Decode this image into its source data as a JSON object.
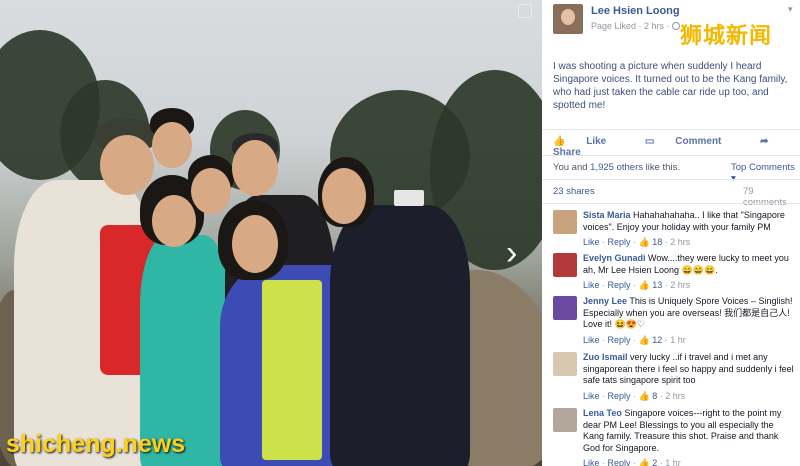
{
  "watermark": "shicheng.news",
  "header": {
    "page_name": "Lee Hsien Loong",
    "meta": "Page Liked · 2 hrs ·",
    "brand": "狮城新闻"
  },
  "post": {
    "text": "I was shooting a picture when suddenly I heard Singapore voices. It turned out to be the Kang family, who had just taken the cable car ride up too, and spotted me!"
  },
  "actions": {
    "like": "Like",
    "comment": "Comment",
    "share": "Share"
  },
  "stats": {
    "likes_prefix": "You and ",
    "likes_link": "1,925 others",
    "likes_suffix": " like this.",
    "top_comments": "Top Comments ▾",
    "shares": "23 shares",
    "comments": "79 comments"
  },
  "comments": [
    {
      "name": "Sista Maria",
      "text": "Hahahahahaha.. I like that \"Singapore voices\". Enjoy your holiday with your family PM",
      "like": "Like",
      "reply": "Reply",
      "likes_count": "18",
      "time": "2 hrs",
      "avatar_color": "#c9a27e"
    },
    {
      "name": "Evelyn Gunadi",
      "text": "Wow....they were lucky to meet you ah, Mr Lee Hsien Loong 😄😄😄.",
      "like": "Like",
      "reply": "Reply",
      "likes_count": "13",
      "time": "2 hrs",
      "avatar_color": "#b33a3a"
    },
    {
      "name": "Jenny Lee",
      "text": "This is Uniquely Spore Voices – Singlish! Especially when you are overseas! 我们都是自己人! Love it! 😆😍♡",
      "like": "Like",
      "reply": "Reply",
      "likes_count": "12",
      "time": "1 hr",
      "avatar_color": "#6a4aa0"
    },
    {
      "name": "Zuo Ismail",
      "text": "very lucky ..if i travel and i met any singaporean there i feel so happy and suddenly i feel safe tats singapore spirit too",
      "like": "Like",
      "reply": "Reply",
      "likes_count": "8",
      "time": "2 hrs",
      "avatar_color": "#d8c7b0"
    },
    {
      "name": "Lena Teo",
      "text": "Singapore voices---right to the point my dear PM Lee! Blessings to you all especially the Kang family. Treasure this shot. Praise and thank God for Singapore.",
      "like": "Like",
      "reply": "Reply",
      "likes_count": "2",
      "time": "1 hr",
      "avatar_color": "#b0a69a"
    }
  ],
  "icons": {
    "expand": "expand-icon",
    "next": "chevron-right-icon",
    "globe": "globe-icon",
    "like_thumb": "thumbs-up-icon",
    "comment": "comment-icon",
    "share": "share-icon"
  }
}
